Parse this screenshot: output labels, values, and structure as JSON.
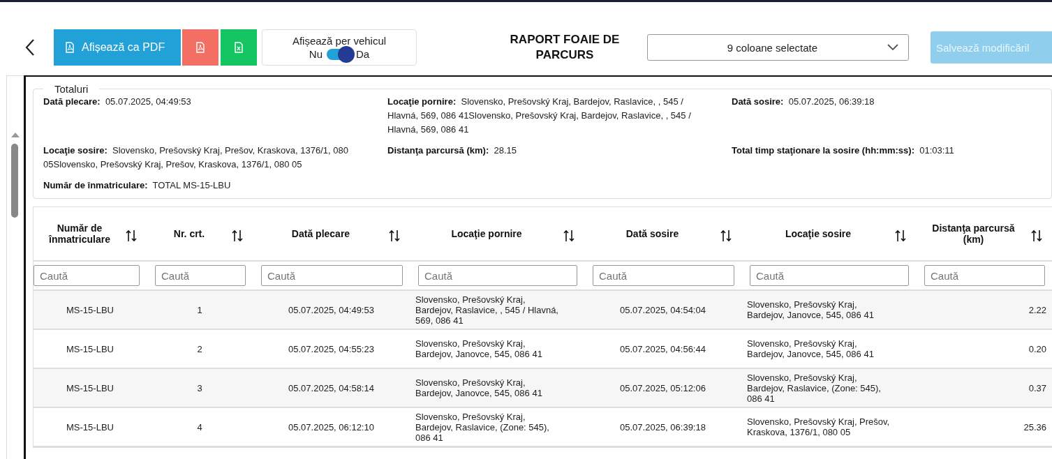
{
  "toolbar": {
    "pdf_view_button": {
      "label": "Afișează ca PDF"
    },
    "per_vehicle": {
      "label": "Afișează per vehicul",
      "off_label": "Nu",
      "on_label": "Da",
      "on": true
    }
  },
  "title": "RAPORT FOAIE DE PARCURS",
  "columns_select": {
    "value": "9 coloane selectate"
  },
  "save_button": {
    "label": "Salvează modificăril",
    "disabled": true
  },
  "totals": {
    "legend": "Totaluri",
    "fields": [
      {
        "label": "Dată plecare:",
        "value": "05.07.2025, 04:49:53"
      },
      {
        "label": "Locaţie pornire:",
        "value": "Slovensko, Prešovský Kraj, Bardejov, Raslavice, , 545 / Hlavná, 569, 086 41Slovensko, Prešovský Kraj, Bardejov, Raslavice, , 545 / Hlavná, 569, 086 41"
      },
      {
        "label": "Dată sosire:",
        "value": "05.07.2025, 06:39:18"
      },
      {
        "label": "Locaţie sosire:",
        "value": "Slovensko, Prešovský Kraj, Prešov, Kraskova, 1376/1, 080 05Slovensko, Prešovský Kraj, Prešov, Kraskova, 1376/1, 080 05"
      },
      {
        "label": "Distanţa parcursă (km):",
        "value": "28.15"
      },
      {
        "label": "Total timp staţionare la sosire (hh:mm:ss):",
        "value": "01:03:11"
      },
      {
        "label": "Număr de înmatriculare:",
        "value": "TOTAL MS-15-LBU"
      }
    ]
  },
  "table": {
    "columns": [
      {
        "label": "Număr de înmatriculare",
        "filter_placeholder": "Caută"
      },
      {
        "label": "Nr. crt.",
        "filter_placeholder": "Caută"
      },
      {
        "label": "Dată plecare",
        "filter_placeholder": "Caută"
      },
      {
        "label": "Locaţie pornire",
        "filter_placeholder": "Caută"
      },
      {
        "label": "Dată sosire",
        "filter_placeholder": "Caută"
      },
      {
        "label": "Locaţie sosire",
        "filter_placeholder": "Caută"
      },
      {
        "label": "Distanţa parcursă (km)",
        "filter_placeholder": "Caută"
      }
    ],
    "rows": [
      [
        "MS-15-LBU",
        "1",
        "05.07.2025, 04:49:53",
        "Slovensko, Prešovský Kraj, Bardejov, Raslavice, , 545 / Hlavná, 569, 086 41",
        "05.07.2025, 04:54:04",
        "Slovensko, Prešovský Kraj, Bardejov, Janovce, 545, 086 41",
        "2.22"
      ],
      [
        "MS-15-LBU",
        "2",
        "05.07.2025, 04:55:23",
        "Slovensko, Prešovský Kraj, Bardejov, Janovce, 545, 086 41",
        "05.07.2025, 04:56:44",
        "Slovensko, Prešovský Kraj, Bardejov, Janovce, 545, 086 41",
        "0.20"
      ],
      [
        "MS-15-LBU",
        "3",
        "05.07.2025, 04:58:14",
        "Slovensko, Prešovský Kraj, Bardejov, Janovce, 545, 086 41",
        "05.07.2025, 05:12:06",
        "Slovensko, Prešovský Kraj, Bardejov, Raslavice, (Zone: 545), 086 41",
        "0.37"
      ],
      [
        "MS-15-LBU",
        "4",
        "05.07.2025, 06:12:10",
        "Slovensko, Prešovský Kraj, Bardejov, Raslavice, (Zone: 545), 086 41",
        "05.07.2025, 06:39:18",
        "Slovensko, Prešovský Kraj, Prešov, Kraskova, 1376/1, 080 05",
        "25.36"
      ]
    ]
  }
}
